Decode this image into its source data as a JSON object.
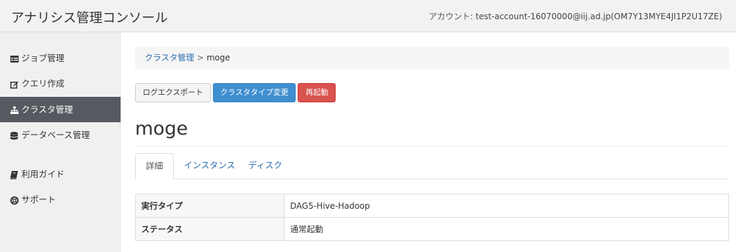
{
  "header": {
    "app_title": "アナリシス管理コンソール",
    "account_label": "アカウント: ",
    "account_value": "test-account-16070000@iij.ad.jp(OM7Y13MYE4JI1P2U17ZE)"
  },
  "sidebar": {
    "items": [
      {
        "label": "ジョブ管理",
        "icon": "job-list-icon",
        "active": false
      },
      {
        "label": "クエリ作成",
        "icon": "edit-icon",
        "active": false
      },
      {
        "label": "クラスタ管理",
        "icon": "sitemap-icon",
        "active": true
      },
      {
        "label": "データベース管理",
        "icon": "database-icon",
        "active": false
      },
      {
        "label": "利用ガイド",
        "icon": "book-icon",
        "active": false
      },
      {
        "label": "サポート",
        "icon": "lifebuoy-icon",
        "active": false
      }
    ]
  },
  "breadcrumb": {
    "parent": "クラスタ管理",
    "separator": ">",
    "current": "moge"
  },
  "actions": {
    "export_log": "ログエクスポート",
    "change_type": "クラスタタイプ変更",
    "restart": "再起動"
  },
  "cluster": {
    "name": "moge"
  },
  "tabs": [
    {
      "label": "詳細",
      "active": true
    },
    {
      "label": "インスタンス",
      "active": false
    },
    {
      "label": "ディスク",
      "active": false
    }
  ],
  "details": [
    {
      "key": "実行タイプ",
      "value": "DAG5-Hive-Hadoop"
    },
    {
      "key": "ステータス",
      "value": "通常起動"
    }
  ],
  "colors": {
    "primary": "#3f8fd0",
    "danger": "#d9534f",
    "sidebar_active": "#555a60",
    "link": "#2a6fb0"
  }
}
